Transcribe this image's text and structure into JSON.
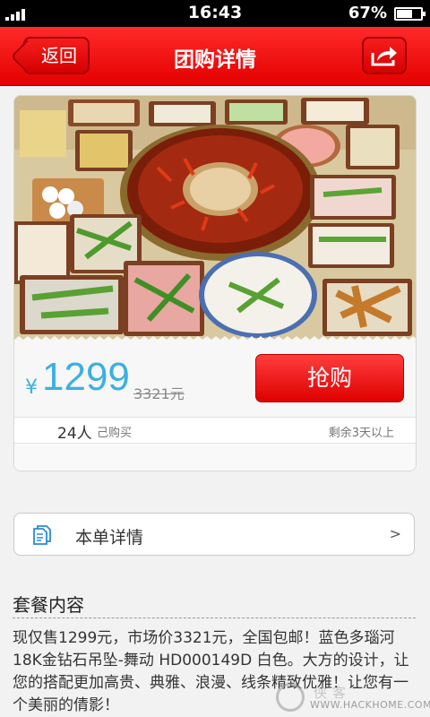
{
  "status_bar": {
    "time": "16:43",
    "battery_percent": "67%",
    "battery_level": 0.67
  },
  "nav": {
    "back_label": "返回",
    "title": "团购详情"
  },
  "deal": {
    "currency": "¥",
    "price": "1299",
    "original_price": "3321元",
    "buy_label": "抢购",
    "bought_count": "24人",
    "bought_label": "己购买",
    "remaining": "剩余3天以上"
  },
  "details": {
    "label": "本单详情",
    "chevron": ">"
  },
  "package": {
    "title": "套餐内容",
    "text": "现仅售1299元，市场价3321元，全国包邮！蓝色多瑙河 18K金钻石吊坠-舞动 HD000149D 白色。大方的设计，让您的搭配更加高贵、典雅、浪漫、线条精致优雅！让您有一个美丽的倩影！"
  },
  "watermark": {
    "text": "WWW.HACKHOME.COM",
    "cn": "侠客"
  },
  "colors": {
    "brand_red": "#e40000",
    "price_blue": "#3bb0e0"
  }
}
